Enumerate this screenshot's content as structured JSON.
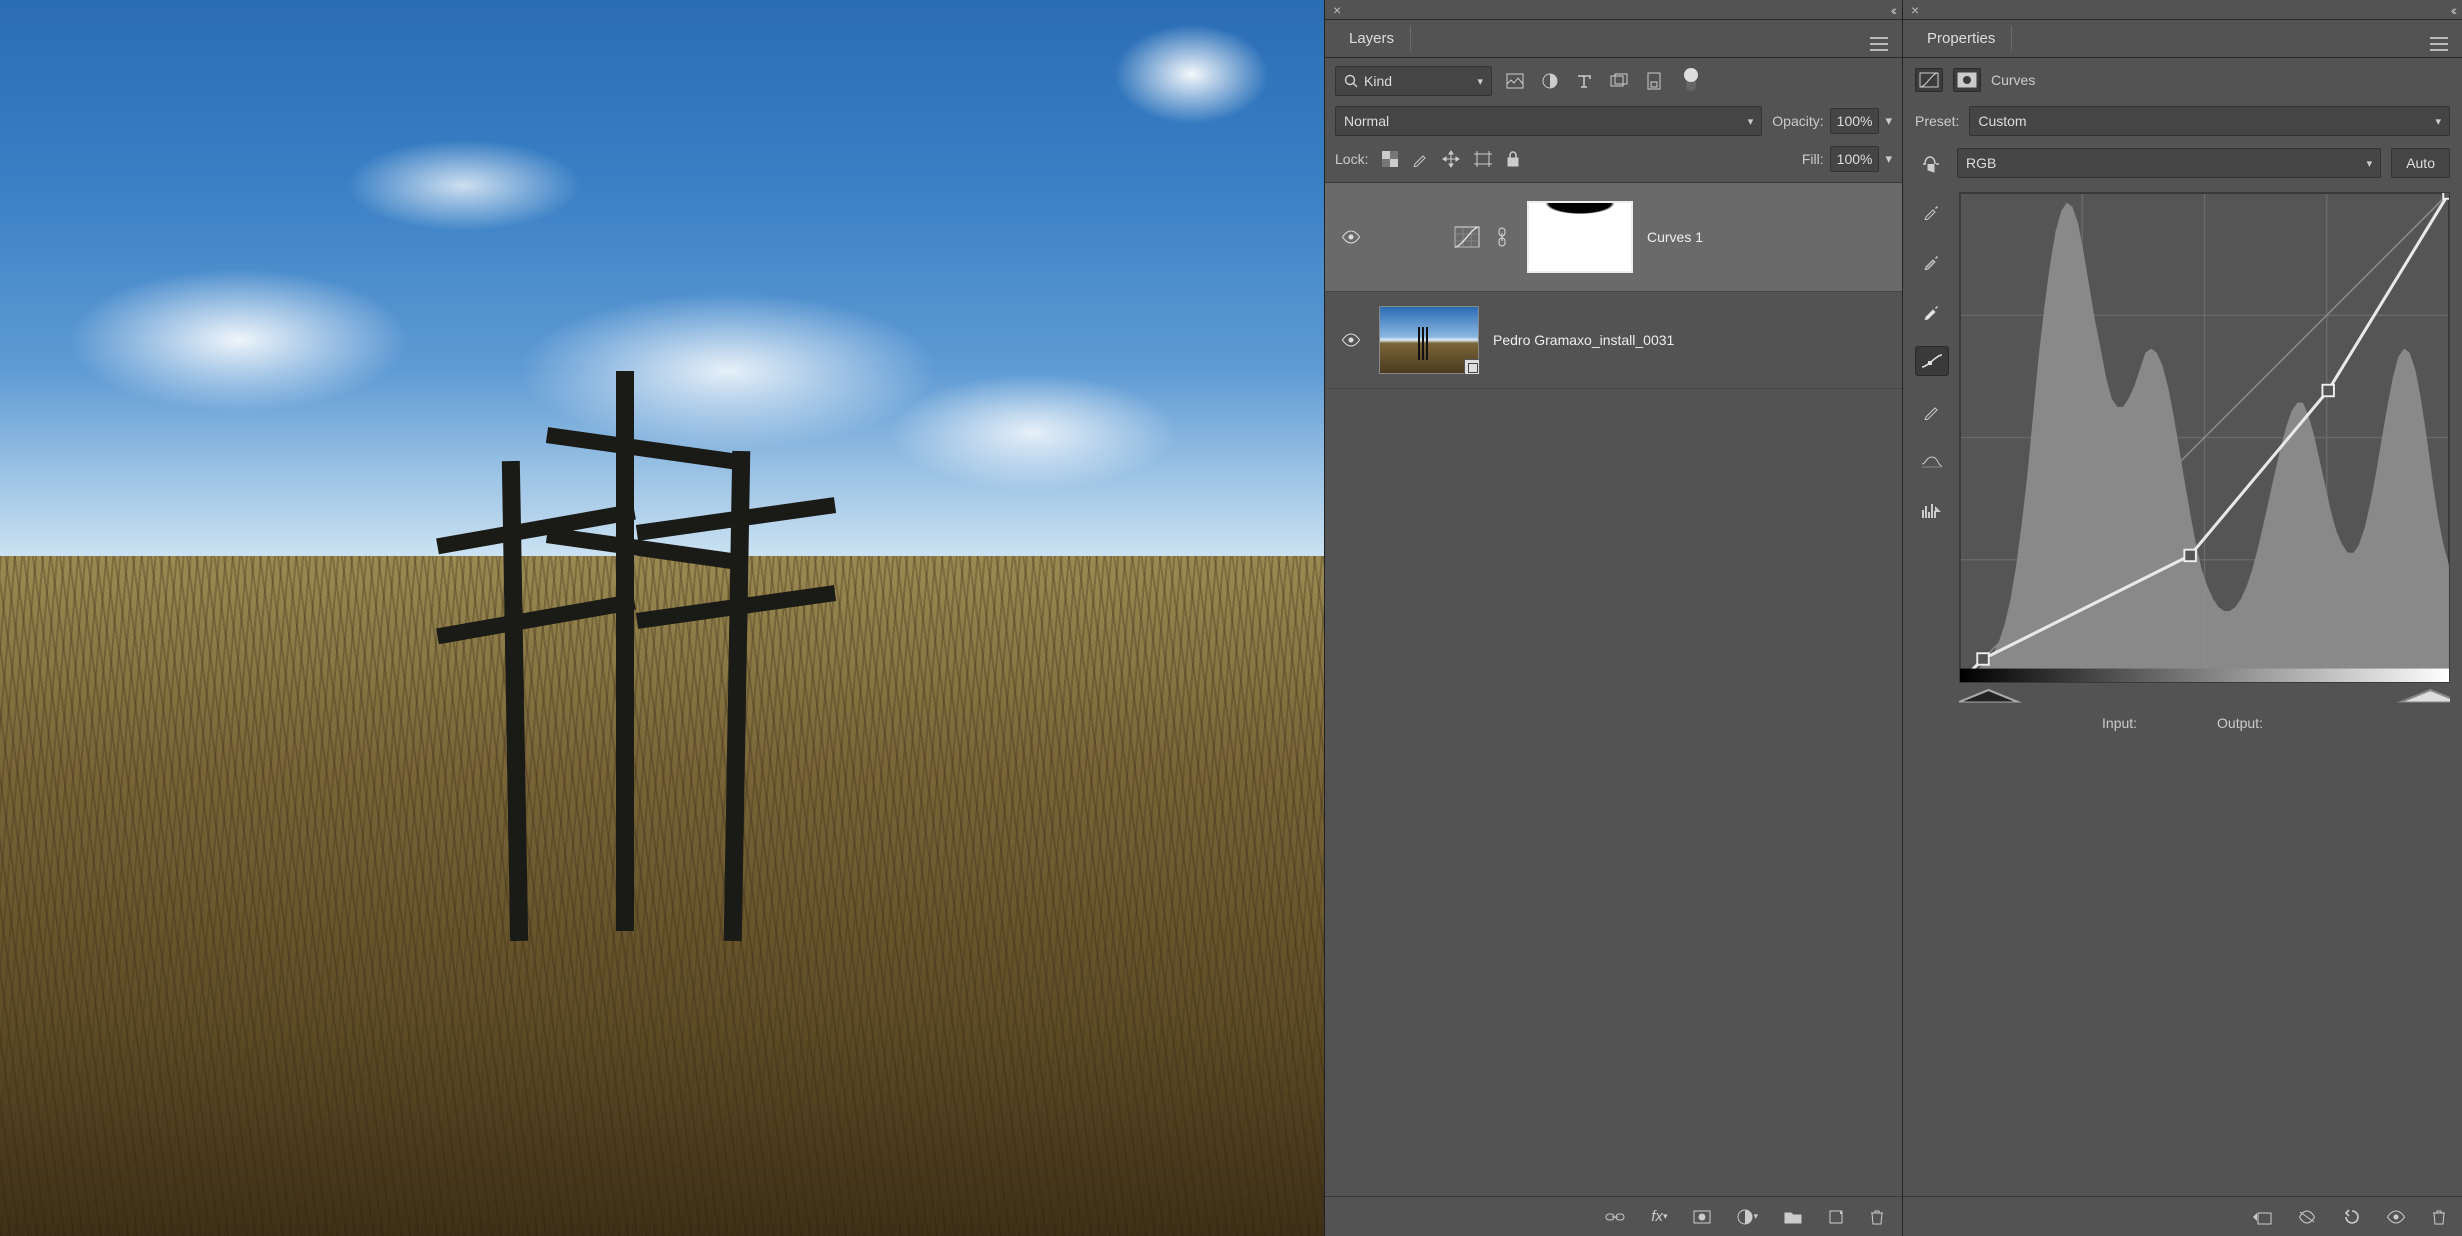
{
  "layers_panel": {
    "tab_label": "Layers",
    "filter_kind_label": "Kind",
    "blend_mode": "Normal",
    "opacity_label": "Opacity:",
    "opacity_value": "100%",
    "lock_label": "Lock:",
    "fill_label": "Fill:",
    "fill_value": "100%",
    "layers": [
      {
        "name": "Curves 1",
        "type": "adjustment-curves",
        "visible": true,
        "selected": true,
        "has_mask": true
      },
      {
        "name": "Pedro Gramaxo_install_0031",
        "type": "smart-object-image",
        "visible": true,
        "selected": false,
        "has_mask": false
      }
    ]
  },
  "properties_panel": {
    "tab_label": "Properties",
    "adjustment_label": "Curves",
    "preset_label": "Preset:",
    "preset_value": "Custom",
    "channel_value": "RGB",
    "auto_label": "Auto",
    "input_label": "Input:",
    "output_label": "Output:"
  },
  "chart_data": {
    "type": "line",
    "title": "Curves — RGB",
    "xlabel": "Input",
    "ylabel": "Output",
    "xlim": [
      0,
      255
    ],
    "ylim": [
      0,
      255
    ],
    "curve_points": [
      {
        "in": 0,
        "out": 0
      },
      {
        "in": 12,
        "out": 12
      },
      {
        "in": 120,
        "out": 66
      },
      {
        "in": 192,
        "out": 152
      },
      {
        "in": 255,
        "out": 255
      }
    ],
    "histogram": [
      2,
      2,
      3,
      3,
      4,
      5,
      7,
      10,
      14,
      20,
      28,
      38,
      50,
      64,
      78,
      90,
      100,
      108,
      113,
      115,
      114,
      110,
      103,
      95,
      87,
      80,
      73,
      68,
      66,
      66,
      68,
      71,
      75,
      79,
      80,
      79,
      76,
      71,
      64,
      56,
      48,
      40,
      33,
      27,
      23,
      20,
      18,
      17,
      17,
      18,
      20,
      23,
      27,
      32,
      38,
      44,
      50,
      56,
      61,
      65,
      67,
      67,
      64,
      59,
      53,
      47,
      41,
      36,
      33,
      31,
      31,
      33,
      37,
      43,
      50,
      58,
      66,
      73,
      78,
      80,
      79,
      75,
      68,
      59,
      49,
      40,
      33,
      28
    ]
  }
}
